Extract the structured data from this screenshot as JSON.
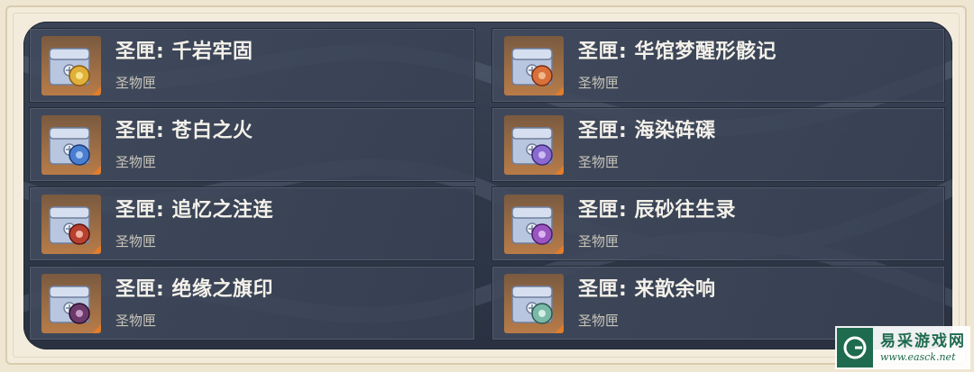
{
  "left_column": [
    {
      "title": "圣匣: 千岩牢固",
      "subtitle": "圣物匣",
      "gem": "amber-flower-icon",
      "gem_color": "#e0b03a"
    },
    {
      "title": "圣匣: 苍白之火",
      "subtitle": "圣物匣",
      "gem": "blue-flower-icon",
      "gem_color": "#4a7fd0"
    },
    {
      "title": "圣匣: 追忆之注连",
      "subtitle": "圣物匣",
      "gem": "red-flower-icon",
      "gem_color": "#b8402f"
    },
    {
      "title": "圣匣: 绝缘之旗印",
      "subtitle": "圣物匣",
      "gem": "dark-purple-flower-icon",
      "gem_color": "#6b3a6a"
    }
  ],
  "right_column": [
    {
      "title": "圣匣: 华馆梦醒形骸记",
      "subtitle": "圣物匣",
      "gem": "orange-flower-icon",
      "gem_color": "#d9703a"
    },
    {
      "title": "圣匣: 海染砗磲",
      "subtitle": "圣物匣",
      "gem": "violet-flower-icon",
      "gem_color": "#8a6ad0"
    },
    {
      "title": "圣匣: 辰砂往生录",
      "subtitle": "圣物匣",
      "gem": "purple-flower-icon",
      "gem_color": "#9a55c0"
    },
    {
      "title": "圣匣: 来歆余响",
      "subtitle": "圣物匣",
      "gem": "teal-flower-icon",
      "gem_color": "#7ab8a8"
    }
  ],
  "colors": {
    "panel": "#2f3848",
    "card_border": "#505b6c",
    "icon_bg": "#a06f45",
    "icon_corner": "#e27d2b",
    "title": "#f4f1ea",
    "subtitle": "#c9c4ba",
    "watermark_green": "#1f6b4f"
  },
  "watermark": {
    "name": "易采游戏网",
    "url": "www.easck.net"
  }
}
